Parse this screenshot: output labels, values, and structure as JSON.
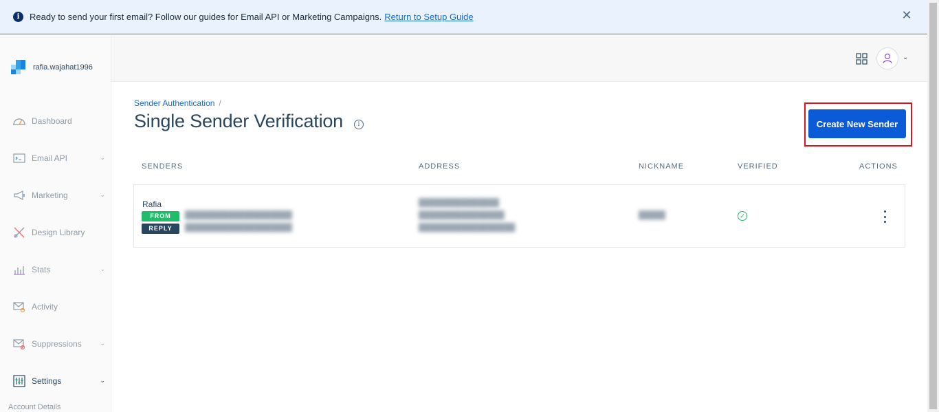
{
  "banner": {
    "message": "Ready to send your first email? Follow our guides for Email API or Marketing Campaigns.",
    "link_text": "Return to Setup Guide"
  },
  "sidebar": {
    "account_name": "rafia.wajahat1996",
    "items": [
      {
        "label": "Dashboard",
        "icon": "dashboard-icon",
        "has_chevron": false
      },
      {
        "label": "Email API",
        "icon": "email-api-icon",
        "has_chevron": true
      },
      {
        "label": "Marketing",
        "icon": "megaphone-icon",
        "has_chevron": true
      },
      {
        "label": "Design Library",
        "icon": "design-library-icon",
        "has_chevron": false
      },
      {
        "label": "Stats",
        "icon": "stats-icon",
        "has_chevron": true
      },
      {
        "label": "Activity",
        "icon": "activity-icon",
        "has_chevron": false
      },
      {
        "label": "Suppressions",
        "icon": "suppressions-icon",
        "has_chevron": true
      },
      {
        "label": "Settings",
        "icon": "settings-icon",
        "has_chevron": true
      }
    ],
    "account_details": "Account Details"
  },
  "breadcrumb": {
    "parent": "Sender Authentication",
    "separator": "/"
  },
  "page": {
    "title": "Single Sender Verification",
    "create_button": "Create New Sender"
  },
  "table": {
    "headers": [
      "SENDERS",
      "ADDRESS",
      "NICKNAME",
      "VERIFIED",
      "ACTIONS"
    ],
    "rows": [
      {
        "sender_name": "Rafia",
        "from_badge": "FROM",
        "reply_badge": "REPLY",
        "verified": true
      }
    ]
  },
  "colors": {
    "primary_button": "#0b5bd8",
    "from_badge": "#1fbc6a",
    "reply_badge": "#294661",
    "highlight": "#e0121d"
  }
}
